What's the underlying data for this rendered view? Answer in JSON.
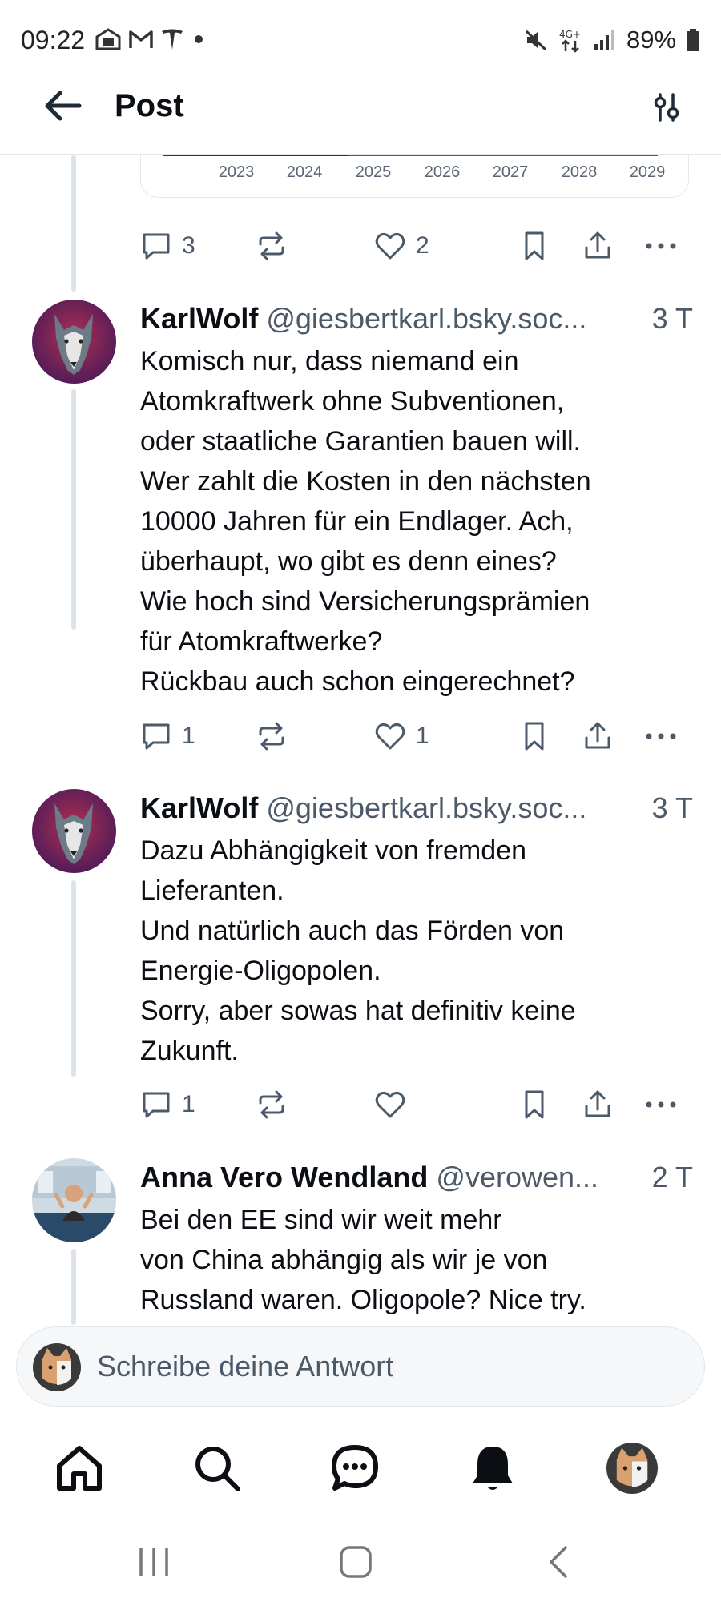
{
  "status_bar": {
    "time": "09:22",
    "notification_icons": [
      "teams-icon",
      "gmail-icon",
      "tesla-icon",
      "dot-icon"
    ],
    "battery": "89%"
  },
  "header": {
    "title": "Post"
  },
  "chart_preview": {
    "years": [
      "2023",
      "2024",
      "2025",
      "2026",
      "2027",
      "2028",
      "2029"
    ]
  },
  "prev_post_actions": {
    "replies": "3",
    "likes": "2"
  },
  "posts": [
    {
      "author": "KarlWolf",
      "handle": "@giesbertkarl.bsky.soc...",
      "time": "3 T",
      "text": "Komisch nur, dass niemand ein\nAtomkraftwerk ohne Subventionen,\noder staatliche Garantien bauen will.\nWer zahlt die Kosten in den nächsten\n10000 Jahren für ein Endlager. Ach,\nüberhaupt, wo gibt es denn eines?\nWie hoch sind Versicherungsprämien\nfür Atomkraftwerke?\nRückbau auch schon eingerechnet?",
      "replies": "1",
      "likes": "1"
    },
    {
      "author": "KarlWolf",
      "handle": "@giesbertkarl.bsky.soc...",
      "time": "3 T",
      "text": "Dazu Abhängigkeit von fremden\nLieferanten.\nUnd natürlich auch das Förden von\nEnergie-Oligopolen.\nSorry, aber sowas hat definitiv keine\nZukunft.",
      "replies": "1",
      "likes": ""
    },
    {
      "author": "Anna Vero Wendland",
      "handle": "@verowen...",
      "time": "2 T",
      "text": "Bei den EE sind wir weit mehr\nvon China abhängig als wir je von\nRussland waren. Oligopole? Nice try."
    }
  ],
  "reply_bar": {
    "placeholder": "Schreibe deine Antwort"
  },
  "colors": {
    "text_primary": "#0b0f14",
    "text_secondary": "#4b5968",
    "thread_line": "#dde3ea",
    "divider": "#e3e7ec"
  }
}
